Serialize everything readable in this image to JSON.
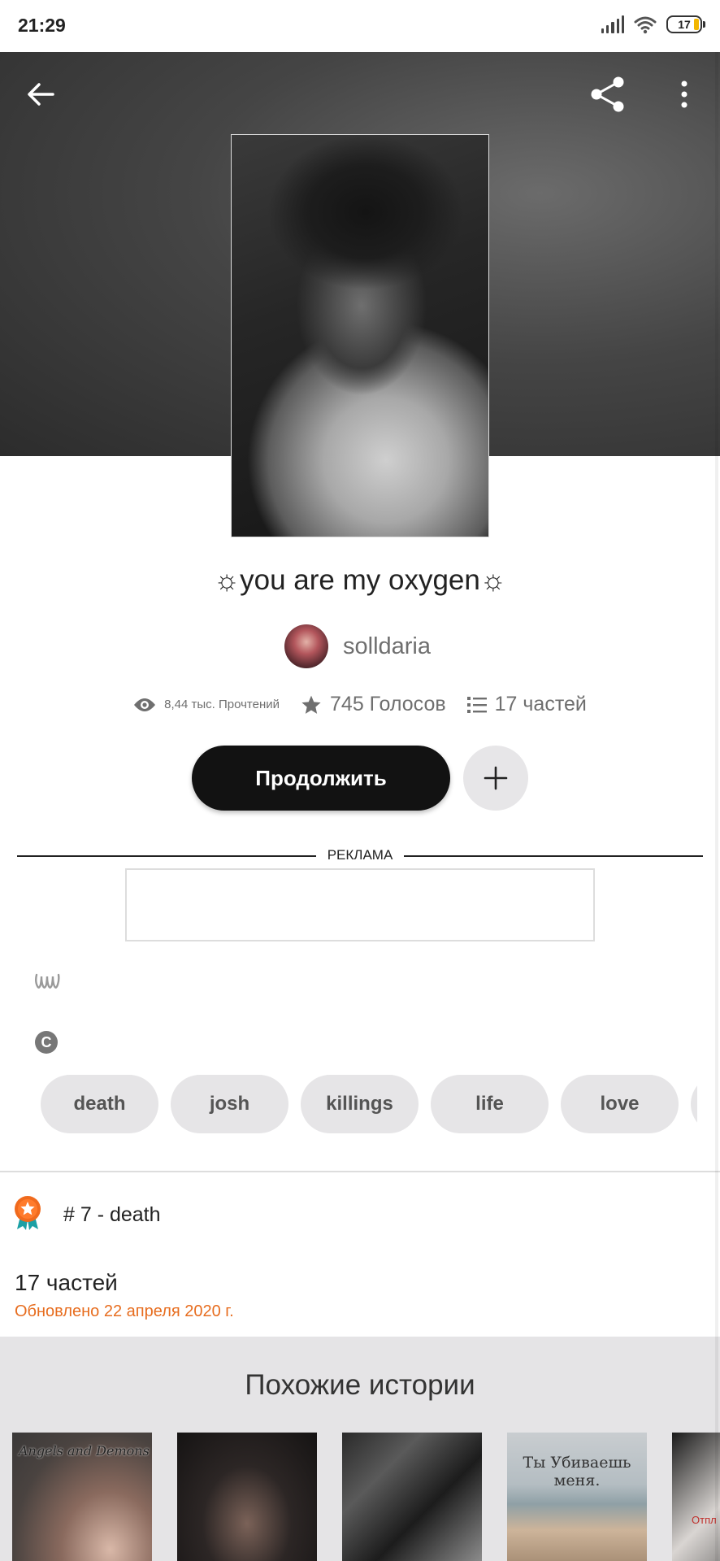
{
  "status_bar": {
    "time": "21:29",
    "battery": "17"
  },
  "story": {
    "title": "☼you are my oxygen☼",
    "author": "solldaria",
    "reads": "8,44 тыс. Прочтений",
    "votes": "745 Голосов",
    "parts": "17 частей"
  },
  "actions": {
    "continue_label": "Продолжить"
  },
  "ad": {
    "label": "РЕКЛАМА"
  },
  "tags": [
    "death",
    "josh",
    "killings",
    "life",
    "love",
    ""
  ],
  "ranking": {
    "text": "# 7 - death"
  },
  "parts_section": {
    "title": "17 частей",
    "updated": "Обновлено 22 апреля 2020 г."
  },
  "similar": {
    "title": "Похожие истории",
    "covers": [
      {
        "caption": "Angels and Demons"
      },
      {
        "caption": ""
      },
      {
        "caption": ""
      },
      {
        "caption": "Ты Убиваешь меня."
      },
      {
        "caption": "Отпл"
      }
    ]
  },
  "colors": {
    "accent": "#e76d1f",
    "dark_button": "#121212",
    "chip_bg": "#e6e5e7",
    "similar_bg": "#e5e4e6"
  }
}
